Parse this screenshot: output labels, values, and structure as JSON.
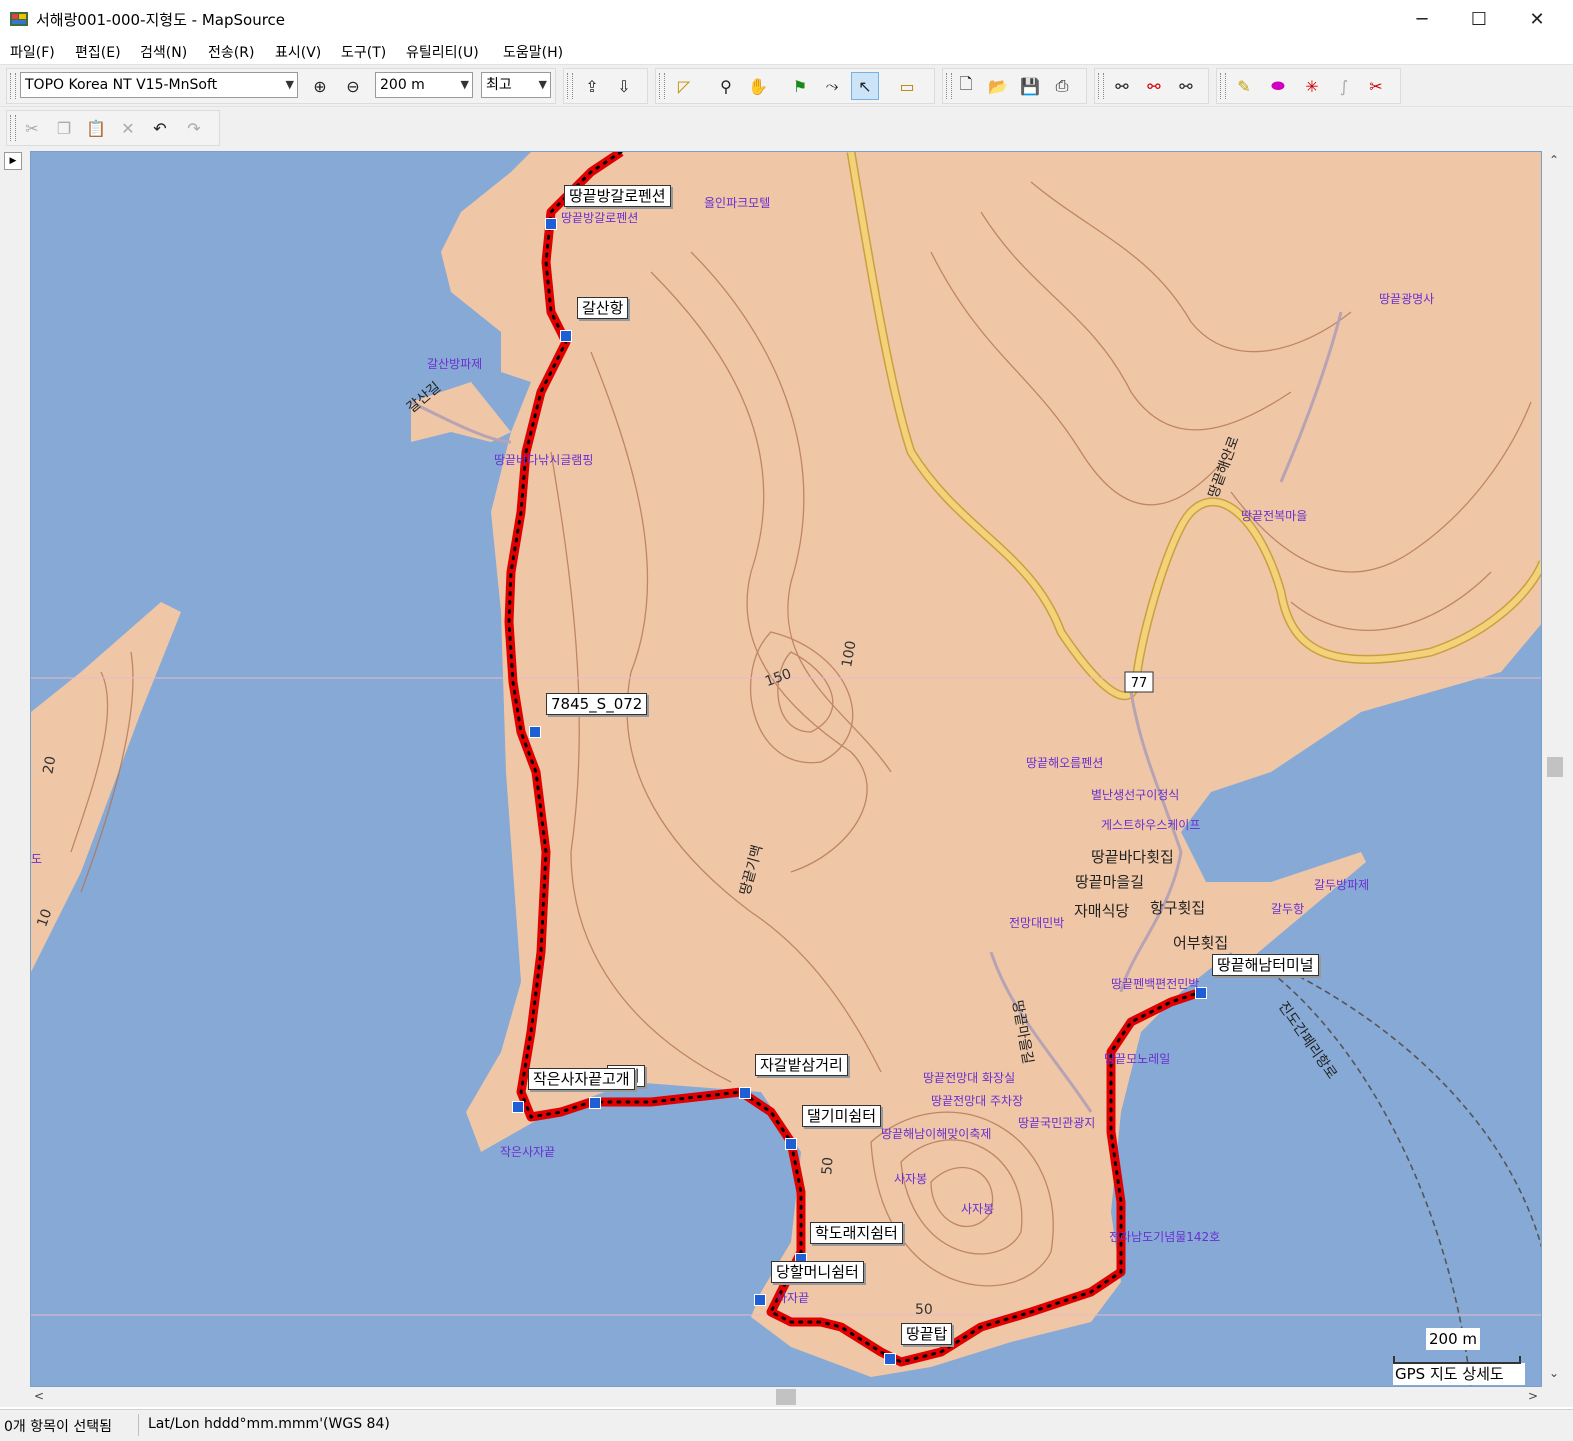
{
  "window": {
    "title": "서해랑001-000-지형도 - MapSource",
    "min_glyph": "─",
    "max_glyph": "☐",
    "close_glyph": "✕"
  },
  "menu": [
    "파일(F)",
    "편집(E)",
    "검색(N)",
    "전송(R)",
    "표시(V)",
    "도구(T)",
    "유틸리티(U)",
    "도움말(H)"
  ],
  "toolbar": {
    "map_product": "TOPO Korea NT V15-MnSoft",
    "zoom_scale": "200 m",
    "detail": "최고"
  },
  "map": {
    "waypoints": [
      {
        "label": "땅끝방갈로펜션"
      },
      {
        "label": "갈산항"
      },
      {
        "label": "7845_S_072"
      },
      {
        "label": "작은사자끝고개"
      },
      {
        "label": "쉼터"
      },
      {
        "label": "자갈밭삼거리"
      },
      {
        "label": "댈기미쉼터"
      },
      {
        "label": "학도래지쉼터"
      },
      {
        "label": "당할머니쉼터"
      },
      {
        "label": "땅끝탑"
      },
      {
        "label": "땅끝해남터미널"
      }
    ],
    "pois": [
      "땅끝방갈로펜션",
      "올인파크모텔",
      "갈산방파제",
      "땅끝바다낚시글램핑",
      "땅끝광명사",
      "땅끝전복마을",
      "땅끝해오름펜션",
      "별난생선구이정식",
      "게스트하우스케이프",
      "전망대민박",
      "땅끝펜백편전민박",
      "갈두방파제",
      "갈두항",
      "땅끝모노레일",
      "땅끝전망대 화장실",
      "땅끝전망대 주차장",
      "땅끝국민관광지",
      "땅끝해남이해맞이축제",
      "사자봉",
      "사자봉",
      "작은사자끝",
      "사자끝",
      "전라남도기념물142호"
    ],
    "place_labels": [
      "땅끝바다횟집",
      "땅끝마을길",
      "자매식당",
      "항구횟집",
      "어부횟집"
    ],
    "road_labels": [
      "갈산길",
      "땅끝해안로",
      "땅끝기맥",
      "땅끝마을길",
      "진도간페리항로"
    ],
    "contour_labels": [
      "150",
      "100",
      "50",
      "50",
      "20",
      "10"
    ],
    "route_shield": "77",
    "edge_label": "도",
    "scale_text": "200 m",
    "map_source_text": "GPS 지도 상세도"
  },
  "status": {
    "selection": "0개 항목이 선택됨",
    "coord_format": "Lat/Lon hddd°mm.mmm'(WGS 84)"
  },
  "colors": {
    "water": "#87a9d6",
    "land": "#efc7a6",
    "track": "#e00000",
    "road": "#e8c060",
    "contour": "#b07050",
    "poi_text": "#6a2fd0"
  }
}
